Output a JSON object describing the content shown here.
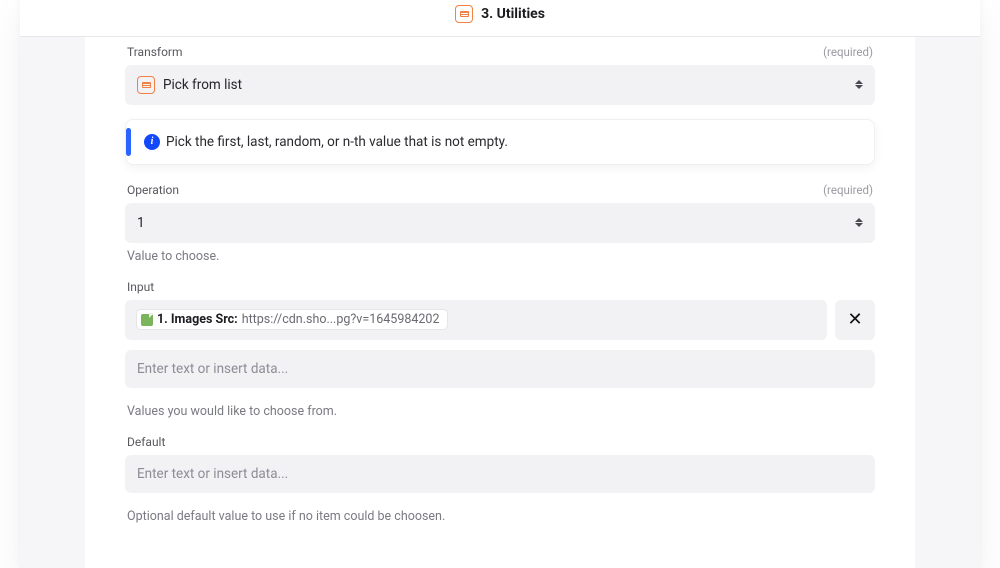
{
  "header": {
    "step_number_and_name": "3. Utilities"
  },
  "fields": {
    "transform": {
      "label": "Transform",
      "required_tag": "(required)",
      "value": "Pick from list"
    },
    "operation": {
      "label": "Operation",
      "required_tag": "(required)",
      "value": "1",
      "help": "Value to choose."
    },
    "input": {
      "label": "Input",
      "chip_prefix": "1. Images Src:",
      "chip_value": "https://cdn.sho...pg?v=1645984202",
      "placeholder": "Enter text or insert data...",
      "help": "Values you would like to choose from."
    },
    "default": {
      "label": "Default",
      "placeholder": "Enter text or insert data...",
      "help": "Optional default value to use if no item could be choosen."
    }
  },
  "callout": {
    "text": "Pick the first, last, random, or n-th value that is not empty."
  },
  "icons": {
    "close": "✕"
  }
}
